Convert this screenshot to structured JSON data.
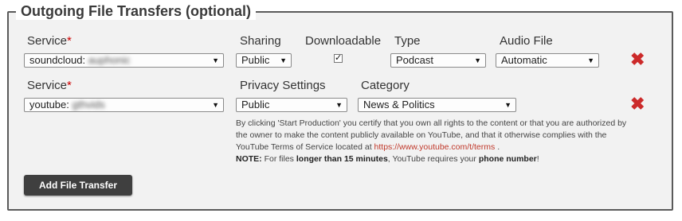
{
  "legend": "Outgoing File Transfers (optional)",
  "row1": {
    "service_label": "Service",
    "required_mark": "*",
    "service_value": "soundcloud:",
    "service_account": "auphonic",
    "sharing_label": "Sharing",
    "sharing_value": "Public",
    "downloadable_label": "Downloadable",
    "downloadable_checked": true,
    "downloadable_mark": "✓",
    "type_label": "Type",
    "type_value": "Podcast",
    "audio_label": "Audio File",
    "audio_value": "Automatic",
    "delete_glyph": "✖"
  },
  "row2": {
    "service_label": "Service",
    "required_mark": "*",
    "service_value": "youtube:",
    "service_account": "gthvids",
    "privacy_label": "Privacy Settings",
    "privacy_value": "Public",
    "category_label": "Category",
    "category_value": "News & Politics",
    "delete_glyph": "✖"
  },
  "notice": {
    "text": "By clicking 'Start Production' you certify that you own all rights to the content or that you are authorized by the owner to make the content publicly available on YouTube, and that it otherwise complies with the YouTube Terms of Service located at",
    "url": "https://www.youtube.com/t/terms",
    "period": ".",
    "note_label": "NOTE:",
    "note_text_1": "For files",
    "note_bold_1": "longer than 15 minutes",
    "note_text_2": ", YouTube requires your",
    "note_bold_2": "phone number",
    "note_end": "!"
  },
  "add_button": "Add File Transfer",
  "dropdown_arrow": "▼",
  "colors": {
    "required": "#cc0000",
    "delete": "#cc2a2a",
    "link": "#c0392b",
    "button_bg": "#3f3f3f"
  }
}
